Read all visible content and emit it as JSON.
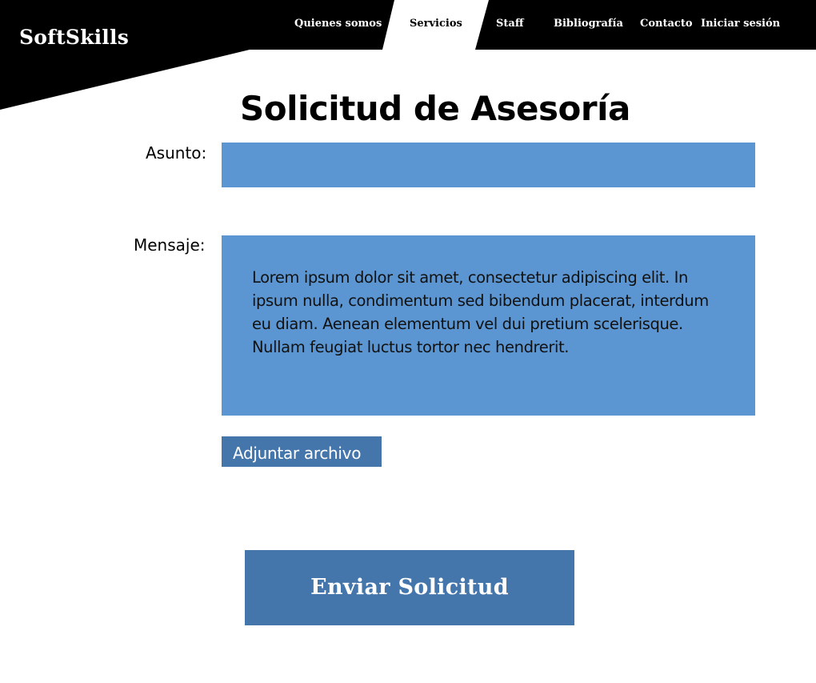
{
  "header": {
    "logo": "SoftSkills",
    "nav": [
      {
        "label": "Quienes somos"
      },
      {
        "label": "Servicios",
        "active": true
      },
      {
        "label": "Staff"
      },
      {
        "label": "Bibliografía"
      },
      {
        "label": "Contacto"
      },
      {
        "label": "Iniciar sesión"
      }
    ]
  },
  "form": {
    "title": "Solicitud de Asesoría",
    "subject_label": "Asunto:",
    "subject_value": "",
    "message_label": "Mensaje:",
    "message_value": "Lorem ipsum dolor sit amet, consectetur adipiscing elit. In ipsum nulla, condimentum sed bibendum placerat, interdum eu diam. Aenean elementum vel dui pretium scelerisque. Nullam feugiat luctus tortor nec hendrerit.",
    "attach_label": "Adjuntar archivo",
    "submit_label": "Enviar Solicitud"
  },
  "colors": {
    "header": "#000000",
    "field": "#5b96d2",
    "button": "#4476ac",
    "active_tab": "#ffffff"
  }
}
